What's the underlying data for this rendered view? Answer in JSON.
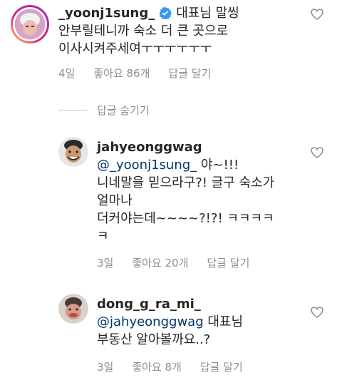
{
  "comments": [
    {
      "username": "_yoonj1sung_",
      "verified": true,
      "line1": "대표님 말씽",
      "line2": "안부릴테니까 숙소 더 큰 곳으로",
      "line3": "이사시켜주세여ㅜㅜㅜㅜㅜㅜ",
      "time": "4일",
      "likes": "좋아요 86개",
      "reply": "답글 달기"
    },
    {
      "username": "jahyeonggwag",
      "mention": "@_yoonj1sung_",
      "line1_rest": " 야~!!!",
      "line2": "니네말을 믿으라구?! 글구 숙소가",
      "line3": "얼마나",
      "line4": "더커야는데~~~~?!?! ㅋㅋㅋㅋ",
      "line5": "ㅋ",
      "time": "3일",
      "likes": "좋아요 20개",
      "reply": "답글 달기"
    },
    {
      "username": "dong_g_ra_mi_",
      "mention": "@jahyeonggwag",
      "line1_rest": " 대표님",
      "line2": "부동산 알아볼까요..?",
      "time": "3일",
      "likes": "좋아요 8개",
      "reply": "답글 달기"
    }
  ],
  "hide_replies": "답글 숨기기",
  "colors": {
    "text": "#262626",
    "meta": "#8e8e8e",
    "mention": "#00376b",
    "verified": "#3897f0",
    "story_ring": "#c13584"
  }
}
